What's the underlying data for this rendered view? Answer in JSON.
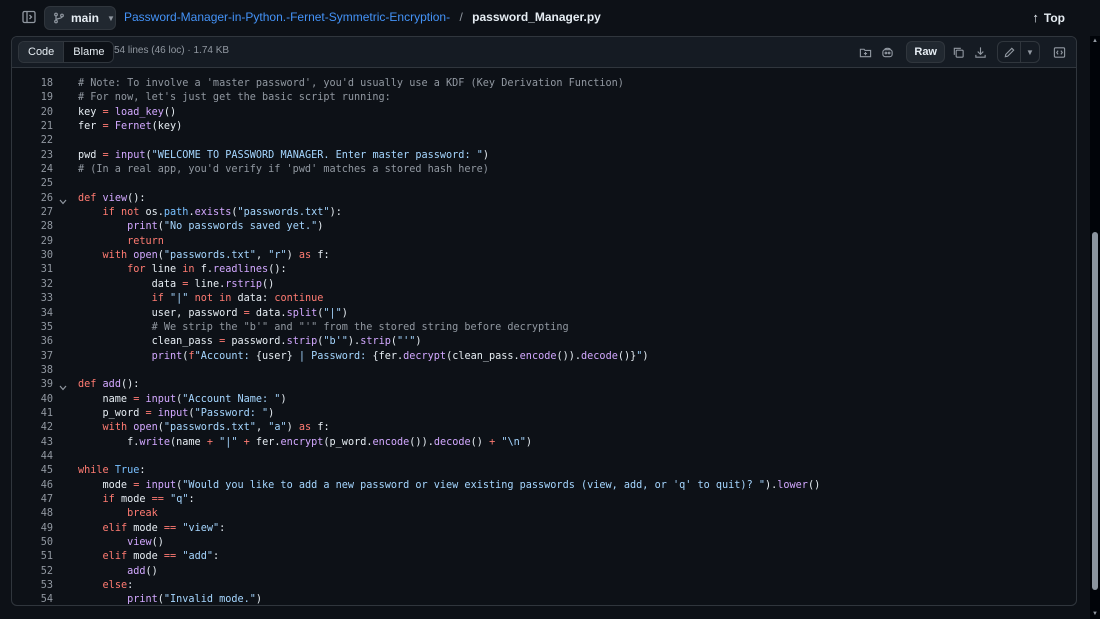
{
  "topbar": {
    "branch": "main",
    "repo_name": "Password-Manager-in-Python.-Fernet-Symmetric-Encryption-",
    "separator": "/",
    "file_name": "password_Manager.py",
    "top_label": "Top"
  },
  "file_header": {
    "code_tab": "Code",
    "blame_tab": "Blame",
    "meta": "54 lines (46 loc) · 1.74 KB",
    "raw_label": "Raw"
  },
  "code_lines": [
    {
      "n": "18",
      "t": [
        [
          "cm",
          "# Note: To involve a 'master password', you'd usually use a KDF (Key Derivation Function)"
        ]
      ]
    },
    {
      "n": "19",
      "t": [
        [
          "cm",
          "# For now, let's just get the basic script running:"
        ]
      ]
    },
    {
      "n": "20",
      "t": [
        [
          "",
          "key "
        ],
        [
          "kw",
          "="
        ],
        [
          "",
          " "
        ],
        [
          "fn",
          "load_key"
        ],
        [
          "",
          "()"
        ]
      ]
    },
    {
      "n": "21",
      "t": [
        [
          "",
          "fer "
        ],
        [
          "kw",
          "="
        ],
        [
          "",
          " "
        ],
        [
          "fn",
          "Fernet"
        ],
        [
          "",
          "(key)"
        ]
      ]
    },
    {
      "n": "22",
      "t": []
    },
    {
      "n": "23",
      "t": [
        [
          "",
          "pwd "
        ],
        [
          "kw",
          "="
        ],
        [
          "",
          " "
        ],
        [
          "fn",
          "input"
        ],
        [
          "",
          "("
        ],
        [
          "st",
          "\"WELCOME TO PASSWORD MANAGER. Enter master password: \""
        ],
        [
          "",
          ")"
        ]
      ]
    },
    {
      "n": "24",
      "t": [
        [
          "cm",
          "# (In a real app, you'd verify if 'pwd' matches a stored hash here)"
        ]
      ]
    },
    {
      "n": "25",
      "t": []
    },
    {
      "n": "26",
      "fold": true,
      "t": [
        [
          "kw",
          "def"
        ],
        [
          "",
          " "
        ],
        [
          "fn",
          "view"
        ],
        [
          "",
          "():"
        ]
      ]
    },
    {
      "n": "27",
      "t": [
        [
          "",
          "    "
        ],
        [
          "kw",
          "if not"
        ],
        [
          "",
          " os."
        ],
        [
          "vr",
          "path"
        ],
        [
          "",
          "."
        ],
        [
          "fn",
          "exists"
        ],
        [
          "",
          "("
        ],
        [
          "st",
          "\"passwords.txt\""
        ],
        [
          "",
          "):"
        ]
      ]
    },
    {
      "n": "28",
      "t": [
        [
          "",
          "        "
        ],
        [
          "fn",
          "print"
        ],
        [
          "",
          "("
        ],
        [
          "st",
          "\"No passwords saved yet.\""
        ],
        [
          "",
          ")"
        ]
      ]
    },
    {
      "n": "29",
      "t": [
        [
          "",
          "        "
        ],
        [
          "kw",
          "return"
        ]
      ]
    },
    {
      "n": "30",
      "t": [
        [
          "",
          "    "
        ],
        [
          "kw",
          "with"
        ],
        [
          "",
          " "
        ],
        [
          "fn",
          "open"
        ],
        [
          "",
          "("
        ],
        [
          "st",
          "\"passwords.txt\""
        ],
        [
          "",
          ", "
        ],
        [
          "st",
          "\"r\""
        ],
        [
          "",
          ") "
        ],
        [
          "kw",
          "as"
        ],
        [
          "",
          " f:"
        ]
      ]
    },
    {
      "n": "31",
      "t": [
        [
          "",
          "        "
        ],
        [
          "kw",
          "for"
        ],
        [
          "",
          " line "
        ],
        [
          "kw",
          "in"
        ],
        [
          "",
          " f."
        ],
        [
          "fn",
          "readlines"
        ],
        [
          "",
          "():"
        ]
      ]
    },
    {
      "n": "32",
      "t": [
        [
          "",
          "            data "
        ],
        [
          "kw",
          "="
        ],
        [
          "",
          " line."
        ],
        [
          "fn",
          "rstrip"
        ],
        [
          "",
          "()"
        ]
      ]
    },
    {
      "n": "33",
      "t": [
        [
          "",
          "            "
        ],
        [
          "kw",
          "if"
        ],
        [
          "",
          " "
        ],
        [
          "st",
          "\"|\""
        ],
        [
          "",
          " "
        ],
        [
          "kw",
          "not in"
        ],
        [
          "",
          " data: "
        ],
        [
          "kw",
          "continue"
        ]
      ]
    },
    {
      "n": "34",
      "t": [
        [
          "",
          "            user, password "
        ],
        [
          "kw",
          "="
        ],
        [
          "",
          " data."
        ],
        [
          "fn",
          "split"
        ],
        [
          "",
          "("
        ],
        [
          "st",
          "\"|\""
        ],
        [
          "",
          ")"
        ]
      ]
    },
    {
      "n": "35",
      "t": [
        [
          "",
          "            "
        ],
        [
          "cm",
          "# We strip the \"b'\" and \"'\" from the stored string before decrypting"
        ]
      ]
    },
    {
      "n": "36",
      "t": [
        [
          "",
          "            clean_pass "
        ],
        [
          "kw",
          "="
        ],
        [
          "",
          " password."
        ],
        [
          "fn",
          "strip"
        ],
        [
          "",
          "("
        ],
        [
          "st",
          "\"b'\""
        ],
        [
          "",
          ")."
        ],
        [
          "fn",
          "strip"
        ],
        [
          "",
          "("
        ],
        [
          "st",
          "\"'\""
        ],
        [
          "",
          ")"
        ]
      ]
    },
    {
      "n": "37",
      "t": [
        [
          "",
          "            "
        ],
        [
          "fn",
          "print"
        ],
        [
          "",
          "("
        ],
        [
          "kw",
          "f"
        ],
        [
          "st",
          "\"Account: "
        ],
        [
          "",
          "{user}"
        ],
        [
          "st",
          " | Password: "
        ],
        [
          "",
          "{fer."
        ],
        [
          "fn",
          "decrypt"
        ],
        [
          "",
          "(clean_pass."
        ],
        [
          "fn",
          "encode"
        ],
        [
          "",
          "())."
        ],
        [
          "fn",
          "decode"
        ],
        [
          "",
          "()}"
        ],
        [
          "st",
          "\""
        ],
        [
          "",
          ")"
        ]
      ]
    },
    {
      "n": "38",
      "t": []
    },
    {
      "n": "39",
      "fold": true,
      "t": [
        [
          "kw",
          "def"
        ],
        [
          "",
          " "
        ],
        [
          "fn",
          "add"
        ],
        [
          "",
          "():"
        ]
      ]
    },
    {
      "n": "40",
      "t": [
        [
          "",
          "    name "
        ],
        [
          "kw",
          "="
        ],
        [
          "",
          " "
        ],
        [
          "fn",
          "input"
        ],
        [
          "",
          "("
        ],
        [
          "st",
          "\"Account Name: \""
        ],
        [
          "",
          ")"
        ]
      ]
    },
    {
      "n": "41",
      "t": [
        [
          "",
          "    p_word "
        ],
        [
          "kw",
          "="
        ],
        [
          "",
          " "
        ],
        [
          "fn",
          "input"
        ],
        [
          "",
          "("
        ],
        [
          "st",
          "\"Password: \""
        ],
        [
          "",
          ")"
        ]
      ]
    },
    {
      "n": "42",
      "t": [
        [
          "",
          "    "
        ],
        [
          "kw",
          "with"
        ],
        [
          "",
          " "
        ],
        [
          "fn",
          "open"
        ],
        [
          "",
          "("
        ],
        [
          "st",
          "\"passwords.txt\""
        ],
        [
          "",
          ", "
        ],
        [
          "st",
          "\"a\""
        ],
        [
          "",
          ") "
        ],
        [
          "kw",
          "as"
        ],
        [
          "",
          " f:"
        ]
      ]
    },
    {
      "n": "43",
      "t": [
        [
          "",
          "        f."
        ],
        [
          "fn",
          "write"
        ],
        [
          "",
          "(name "
        ],
        [
          "kw",
          "+"
        ],
        [
          "",
          " "
        ],
        [
          "st",
          "\"|\""
        ],
        [
          "",
          " "
        ],
        [
          "kw",
          "+"
        ],
        [
          "",
          " fer."
        ],
        [
          "fn",
          "encrypt"
        ],
        [
          "",
          "(p_word."
        ],
        [
          "fn",
          "encode"
        ],
        [
          "",
          "())."
        ],
        [
          "fn",
          "decode"
        ],
        [
          "",
          "() "
        ],
        [
          "kw",
          "+"
        ],
        [
          "",
          " "
        ],
        [
          "st",
          "\"\\n\""
        ],
        [
          "",
          ")"
        ]
      ]
    },
    {
      "n": "44",
      "t": []
    },
    {
      "n": "45",
      "t": [
        [
          "kw",
          "while"
        ],
        [
          "",
          " "
        ],
        [
          "vr",
          "True"
        ],
        [
          "",
          ":"
        ]
      ]
    },
    {
      "n": "46",
      "t": [
        [
          "",
          "    mode "
        ],
        [
          "kw",
          "="
        ],
        [
          "",
          " "
        ],
        [
          "fn",
          "input"
        ],
        [
          "",
          "("
        ],
        [
          "st",
          "\"Would you like to add a new password or view existing passwords (view, add, or 'q' to quit)? \""
        ],
        [
          "",
          ")."
        ],
        [
          "fn",
          "lower"
        ],
        [
          "",
          "()"
        ]
      ]
    },
    {
      "n": "47",
      "t": [
        [
          "",
          "    "
        ],
        [
          "kw",
          "if"
        ],
        [
          "",
          " mode "
        ],
        [
          "kw",
          "=="
        ],
        [
          "",
          " "
        ],
        [
          "st",
          "\"q\""
        ],
        [
          "",
          ":"
        ]
      ]
    },
    {
      "n": "48",
      "t": [
        [
          "",
          "        "
        ],
        [
          "kw",
          "break"
        ]
      ]
    },
    {
      "n": "49",
      "t": [
        [
          "",
          "    "
        ],
        [
          "kw",
          "elif"
        ],
        [
          "",
          " mode "
        ],
        [
          "kw",
          "=="
        ],
        [
          "",
          " "
        ],
        [
          "st",
          "\"view\""
        ],
        [
          "",
          ":"
        ]
      ]
    },
    {
      "n": "50",
      "t": [
        [
          "",
          "        "
        ],
        [
          "fn",
          "view"
        ],
        [
          "",
          "()"
        ]
      ]
    },
    {
      "n": "51",
      "t": [
        [
          "",
          "    "
        ],
        [
          "kw",
          "elif"
        ],
        [
          "",
          " mode "
        ],
        [
          "kw",
          "=="
        ],
        [
          "",
          " "
        ],
        [
          "st",
          "\"add\""
        ],
        [
          "",
          ":"
        ]
      ]
    },
    {
      "n": "52",
      "t": [
        [
          "",
          "        "
        ],
        [
          "fn",
          "add"
        ],
        [
          "",
          "()"
        ]
      ]
    },
    {
      "n": "53",
      "t": [
        [
          "",
          "    "
        ],
        [
          "kw",
          "else"
        ],
        [
          "",
          ":"
        ]
      ]
    },
    {
      "n": "54",
      "t": [
        [
          "",
          "        "
        ],
        [
          "fn",
          "print"
        ],
        [
          "",
          "("
        ],
        [
          "st",
          "\"Invalid mode.\""
        ],
        [
          "",
          ")"
        ]
      ]
    }
  ],
  "icons": {
    "sidebar_toggle": "sidebar-toggle-icon",
    "branch": "git-branch-icon",
    "top_arrow": "arrow-up-icon",
    "toolbar": [
      "symbols-panel-icon",
      "copilot-icon",
      "copy-icon",
      "download-icon",
      "pencil-icon",
      "chevron-down-icon",
      "outline-panel-icon"
    ]
  },
  "colors": {
    "background": "#0d1117",
    "link": "#4493f8",
    "comment": "#9198a1",
    "keyword": "#ff7b72",
    "string": "#a5d6ff",
    "function": "#d2a8ff",
    "constant": "#79c0ff"
  }
}
